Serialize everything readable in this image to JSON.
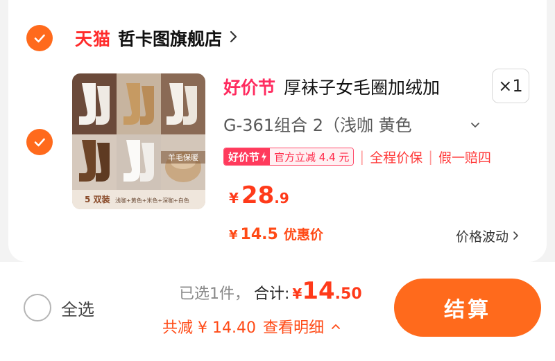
{
  "shop": {
    "platform_logo": "天猫",
    "name": "哲卡图旗舰店"
  },
  "item": {
    "festival_tag": "好价节",
    "title": "厚袜子女毛圈加绒加",
    "quantity": "×1",
    "sku": "G-361组合 2（浅咖 黄色",
    "promo_badge_left": "好价节",
    "promo_badge_right": "官方立减 4.4 元",
    "service_1": "全程价保",
    "service_2": "假一赔四",
    "price_currency": "¥",
    "price_integer": "28",
    "price_decimal": ".9",
    "coupon_currency": "¥",
    "coupon_price": "14.5",
    "coupon_label": "优惠价",
    "price_fluctuation": "价格波动",
    "image_labels": {
      "warm": "羊毛保暖",
      "pack": "5 双装",
      "colors": "浅咖+黄色+米色+深咖+白色"
    }
  },
  "checkout": {
    "select_all": "全选",
    "selected_count": "已选1件，",
    "total_label": "合计:",
    "total_currency": "¥",
    "total_integer": "14",
    "total_decimal": ".50",
    "discount_text": "共减 ¥ 14.40",
    "details_link": "查看明细",
    "button_label": "结算"
  },
  "colors": {
    "accent": "#ff6a1c",
    "price_red": "#ff3a1a",
    "tmall_red": "#ff2b2b"
  }
}
